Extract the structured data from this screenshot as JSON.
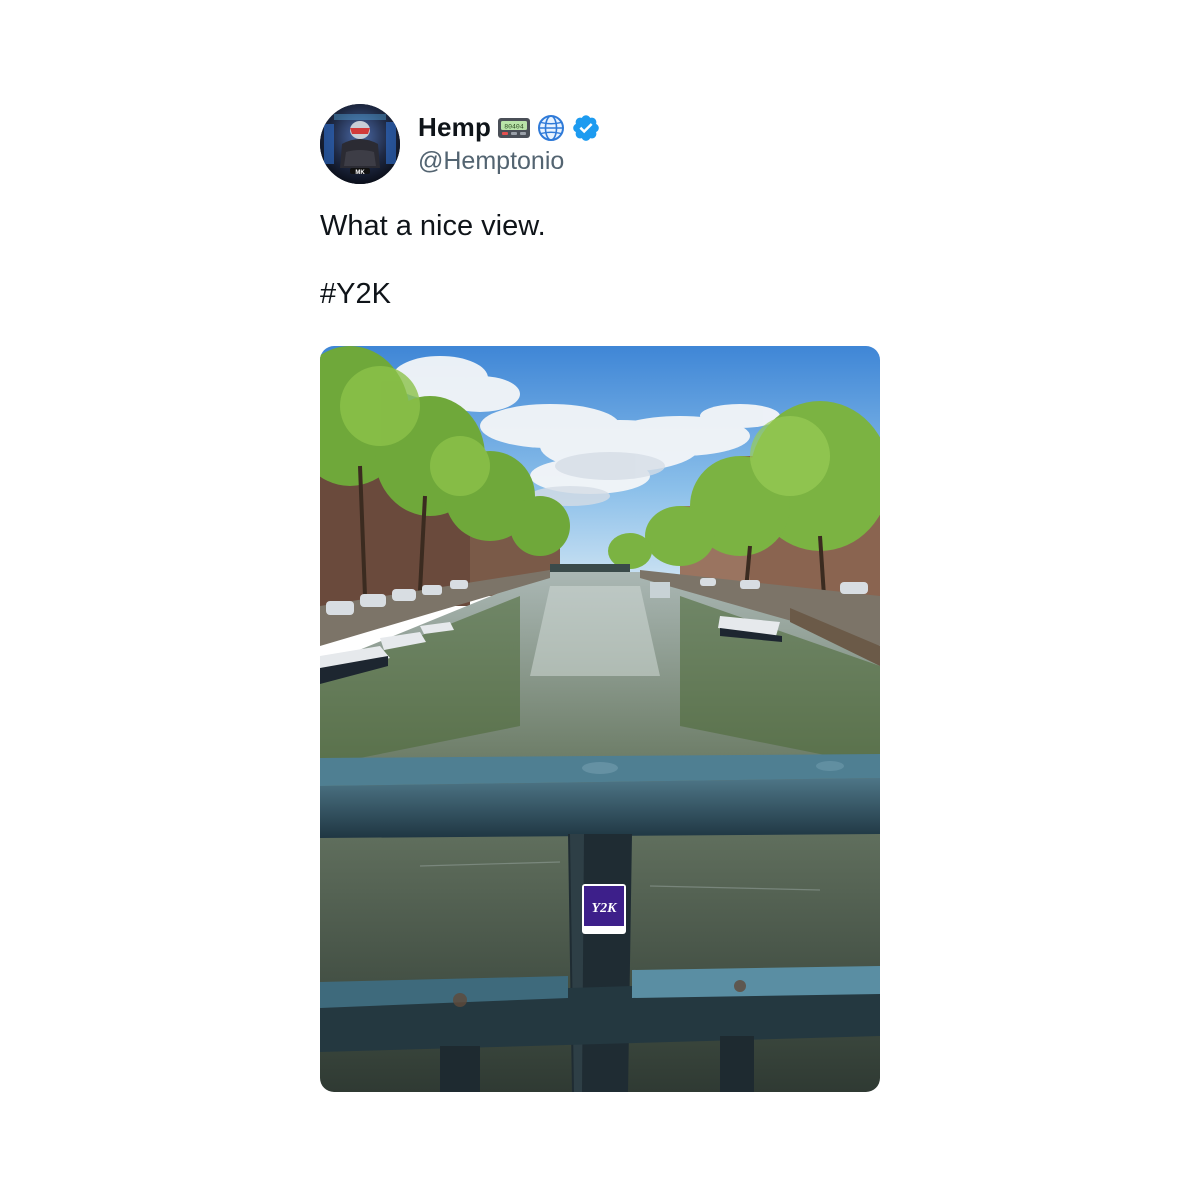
{
  "tweet": {
    "display_name": "Hemp",
    "handle": "@Hemptonio",
    "name_emojis": [
      "pager-icon",
      "globe-icon"
    ],
    "verified": true,
    "text_line1": "What a nice view.",
    "text_line2": "#Y2K",
    "pager_display": "80404",
    "sticker_text": "Y2K"
  },
  "colors": {
    "verified_blue": "#1d9bf0",
    "handle_gray": "#536471",
    "text_black": "#0f1419"
  },
  "avatar_badge": "MK"
}
